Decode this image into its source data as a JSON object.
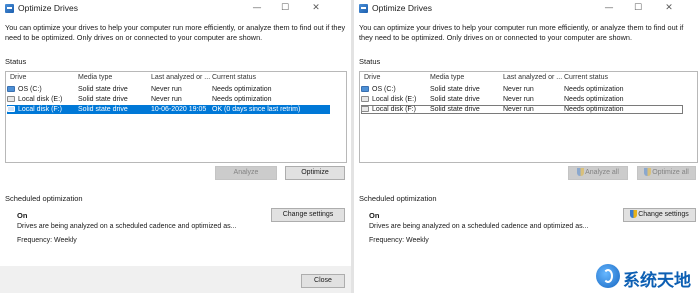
{
  "window_left": {
    "title": "Optimize Drives",
    "controls": {
      "minimize": "—",
      "maximize": "☐",
      "close": "✕"
    },
    "description": "You can optimize your drives to help your computer run more efficiently, or analyze them to find out if they need to be optimized. Only drives on or connected to your computer are shown.",
    "status_label": "Status",
    "columns": [
      "Drive",
      "Media type",
      "Last analyzed or ...",
      "Current status"
    ],
    "rows": [
      {
        "drive": "OS (C:)",
        "media": "Solid state drive",
        "last": "Never run",
        "status": "Needs optimization",
        "state": "normal"
      },
      {
        "drive": "Local disk (E:)",
        "media": "Solid state drive",
        "last": "Never run",
        "status": "Needs optimization",
        "state": "normal"
      },
      {
        "drive": "Local disk (F:)",
        "media": "Solid state drive",
        "last": "10-06-2020 19:05",
        "status": "OK (0 days since last retrim)",
        "state": "selected"
      }
    ],
    "analyze_button": "Analyze",
    "optimize_button": "Optimize",
    "scheduled_label": "Scheduled optimization",
    "schedule_state": "On",
    "change_settings_button": "Change settings",
    "schedule_desc": "Drives are being analyzed on a scheduled cadence and optimized as...",
    "frequency": "Frequency: Weekly",
    "close_button": "Close"
  },
  "window_right": {
    "title": "Optimize Drives",
    "controls": {
      "minimize": "—",
      "maximize": "☐",
      "close": "✕"
    },
    "description": "You can optimize your drives to help your computer run more efficiently, or analyze them to find out if they need to be optimized. Only drives on or connected to your computer are shown.",
    "status_label": "Status",
    "columns": [
      "Drive",
      "Media type",
      "Last analyzed or ...",
      "Current status"
    ],
    "rows": [
      {
        "drive": "OS (C:)",
        "media": "Solid state drive",
        "last": "Never run",
        "status": "Needs optimization",
        "state": "normal"
      },
      {
        "drive": "Local disk (E:)",
        "media": "Solid state drive",
        "last": "Never run",
        "status": "Needs optimization",
        "state": "normal"
      },
      {
        "drive": "Local disk (F:)",
        "media": "Solid state drive",
        "last": "Never run",
        "status": "Needs optimization",
        "state": "focused"
      }
    ],
    "analyze_all_button": "Analyze all",
    "optimize_all_button": "Optimize all",
    "scheduled_label": "Scheduled optimization",
    "schedule_state": "On",
    "change_settings_button": "Change settings",
    "schedule_desc": "Drives are being analyzed on a scheduled cadence and optimized as...",
    "frequency": "Frequency: Weekly"
  },
  "watermark": {
    "text": "系统天地",
    "color": "#0d5fb3"
  },
  "colors": {
    "selection": "#0078d7",
    "disabled_button": "#cccccc",
    "footer": "#f0f0f0"
  }
}
